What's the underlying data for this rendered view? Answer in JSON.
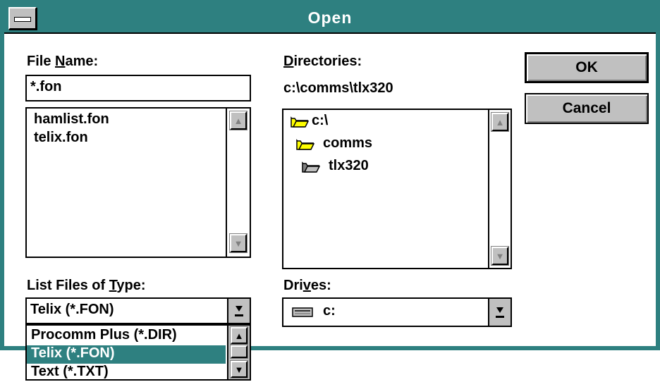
{
  "window": {
    "title": "Open",
    "accent_color": "#2e8080",
    "system_menu_icon": "system-menu-bar-icon"
  },
  "file_name": {
    "label_pre": "File ",
    "label_ul": "N",
    "label_post": "ame:",
    "value": "*.fon",
    "files": [
      "hamlist.fon",
      "telix.fon"
    ]
  },
  "directories": {
    "label_pre": "",
    "label_ul": "D",
    "label_post": "irectories:",
    "current_path": "c:\\comms\\tlx320",
    "tree": [
      {
        "name": "c:\\",
        "icon": "open-folder-icon"
      },
      {
        "name": "comms",
        "icon": "open-folder-icon"
      },
      {
        "name": "tlx320",
        "icon": "open-folder-selected-icon"
      }
    ]
  },
  "buttons": {
    "ok": "OK",
    "cancel": "Cancel"
  },
  "file_type": {
    "label_pre": "List Files of ",
    "label_ul": "T",
    "label_post": "ype:",
    "selected": "Telix (*.FON)",
    "options": [
      "Procomm Plus (*.DIR)",
      "Telix (*.FON)",
      "Text (*.TXT)"
    ],
    "highlighted_index": 1
  },
  "drives": {
    "label_pre": "Dri",
    "label_ul": "v",
    "label_post": "es:",
    "selected": "c:",
    "icon": "hard-drive-icon"
  }
}
